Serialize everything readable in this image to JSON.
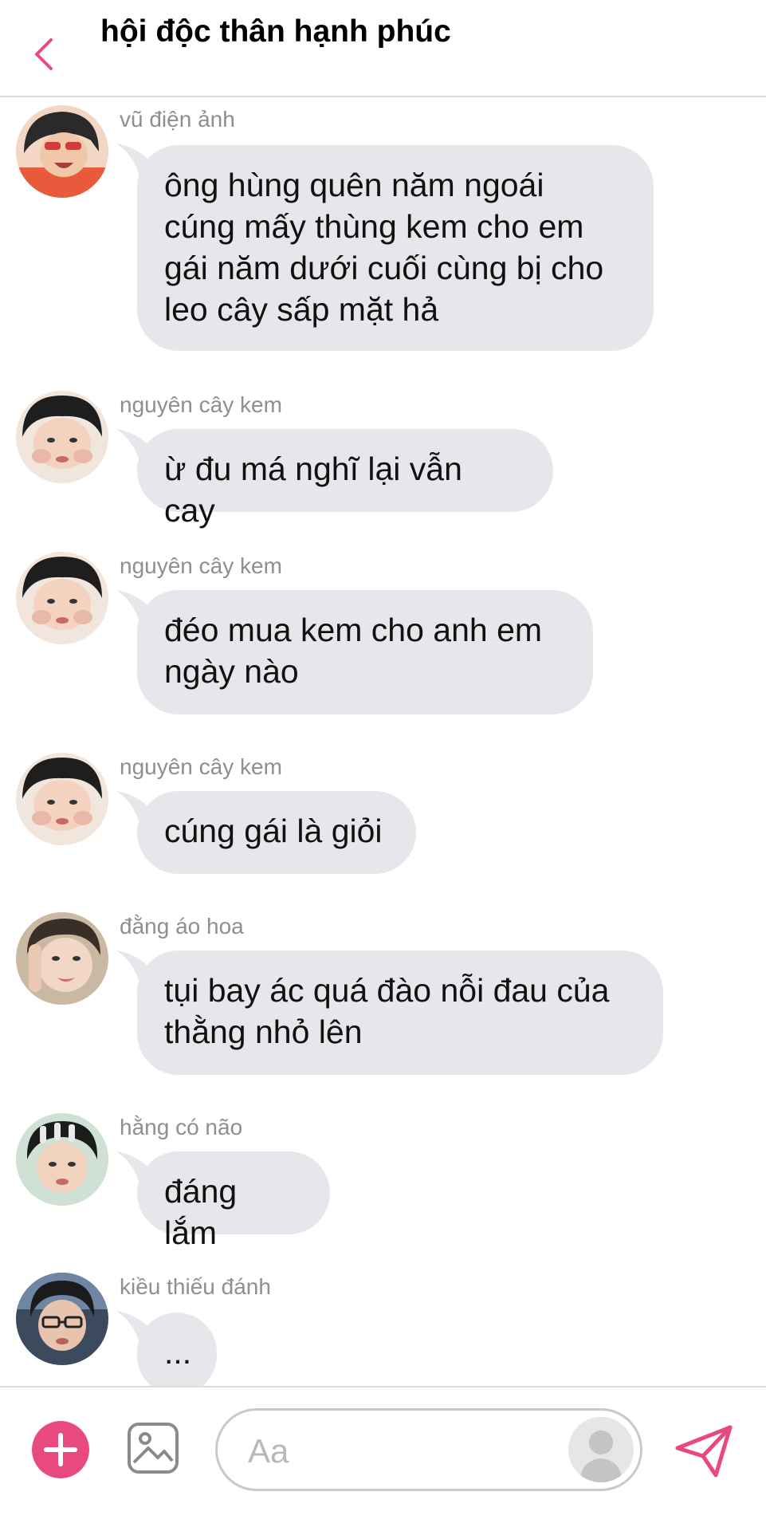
{
  "header": {
    "title": "hội độc thân hạnh phúc",
    "back_icon": "chevron-left-icon",
    "accent": "#e84a80"
  },
  "messages": [
    {
      "sender": "vũ điện ảnh",
      "lines": [
        "ông hùng quên năm ngoái",
        "cúng mấy thùng kem cho em",
        "gái năm dưới cuối cùng bị cho",
        "leo cây sấp mặt hả"
      ]
    },
    {
      "sender": "nguyên cây kem",
      "lines": [
        "ừ đu má nghĩ lại vẫn cay"
      ]
    },
    {
      "sender": "nguyên cây kem",
      "lines": [
        "đéo mua kem cho anh em",
        "ngày nào"
      ]
    },
    {
      "sender": "nguyên cây kem",
      "lines": [
        "cúng gái là giỏi"
      ]
    },
    {
      "sender": "đằng áo hoa",
      "lines": [
        "tụi bay ác quá đào nỗi đau của",
        "thằng nhỏ lên"
      ]
    },
    {
      "sender": "hằng có não",
      "lines": [
        "đáng lắm"
      ]
    },
    {
      "sender": "kiều thiếu đánh",
      "lines": [
        "..."
      ]
    }
  ],
  "input_bar": {
    "placeholder": "Aa",
    "add_icon": "plus-icon",
    "image_icon": "image-icon",
    "send_icon": "send-icon"
  },
  "colors": {
    "bubble": "#e5e7ea",
    "sender_text": "#8e8e93",
    "accent": "#e84a80"
  }
}
